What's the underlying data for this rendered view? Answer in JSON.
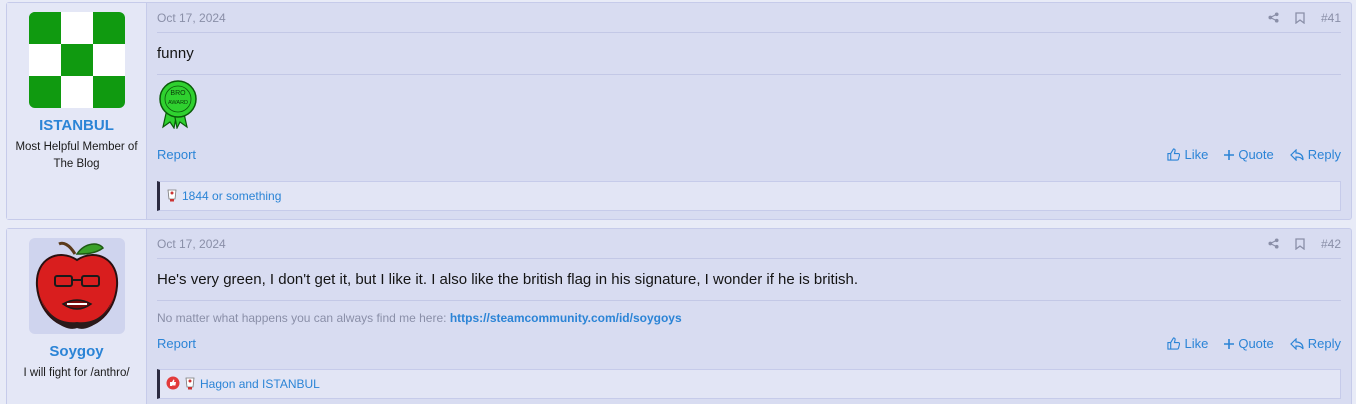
{
  "posts": [
    {
      "number": "#41",
      "date": "Oct 17, 2024",
      "user": {
        "name": "ISTANBUL",
        "title": "Most Helpful Member of The Blog"
      },
      "message": "funny",
      "award_text": "BRO AWARD",
      "actions": {
        "report": "Report",
        "like": "Like",
        "quote": "Quote",
        "reply": "Reply"
      },
      "reactions_text": "1844 or something"
    },
    {
      "number": "#42",
      "date": "Oct 17, 2024",
      "user": {
        "name": "Soygoy",
        "title": "I will fight for /anthro/"
      },
      "message": "He's very green, I don't get it, but I like it. I also like the british flag in his signature, I wonder if he is british.",
      "signature": {
        "text": "No matter what happens you can always find me here: ",
        "link": "https://steamcommunity.com/id/soygoys"
      },
      "actions": {
        "report": "Report",
        "like": "Like",
        "quote": "Quote",
        "reply": "Reply"
      },
      "reactions_text": "Hagon and ISTANBUL"
    }
  ],
  "colors": {
    "accent": "#2b84d6",
    "post_bg": "#d8dcf1",
    "user_bg": "#e4e7f6",
    "award_green": "#2fd12f"
  },
  "icons": [
    "share-icon",
    "bookmark-icon",
    "like-icon",
    "quote-plus-icon",
    "reply-icon",
    "reaction-icon"
  ]
}
